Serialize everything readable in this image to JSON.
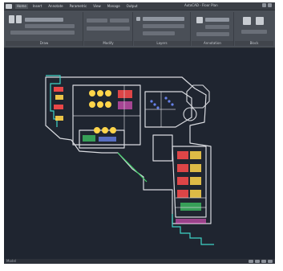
{
  "app": {
    "title": "AutoCAD - Floor Plan",
    "tabs": [
      "Home",
      "Insert",
      "Annotate",
      "Parametric",
      "View",
      "Manage",
      "Output"
    ]
  },
  "ribbon": {
    "panels": [
      "Draw",
      "Modify",
      "Layers",
      "Annotation",
      "Block"
    ]
  },
  "statusbar": {
    "left": "Model"
  },
  "colors": {
    "background": "#1f2530",
    "wall": "#d9dbe0",
    "cyan": "#3fd3c6",
    "red": "#ff4b4b",
    "yellow": "#ffd54a",
    "green": "#41d36a",
    "magenta": "#ff5bd6",
    "blue": "#6f8cff"
  }
}
